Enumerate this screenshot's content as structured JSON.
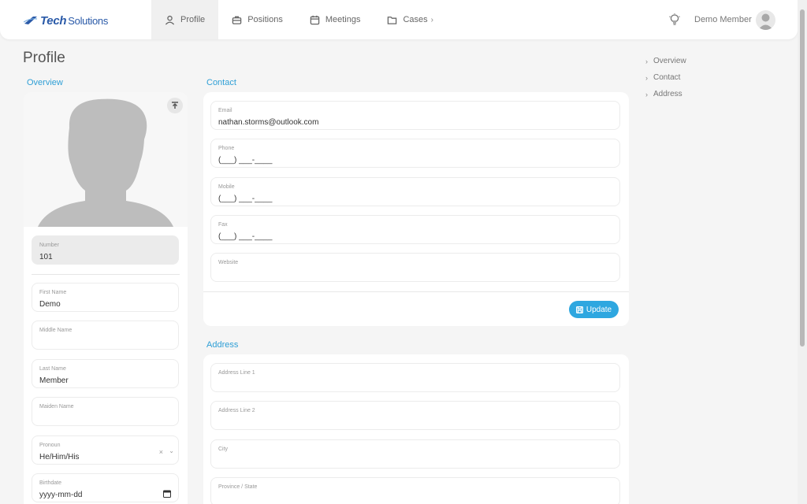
{
  "brand": {
    "tech": "Tech",
    "solutions": "Solutions"
  },
  "nav": {
    "items": [
      {
        "label": "Profile",
        "icon": "user-icon",
        "active": true
      },
      {
        "label": "Positions",
        "icon": "briefcase-icon"
      },
      {
        "label": "Meetings",
        "icon": "calendar-icon"
      },
      {
        "label": "Cases",
        "icon": "folder-icon",
        "chevron": "›"
      }
    ]
  },
  "header": {
    "user_name": "Demo Member",
    "tip_icon": "lightbulb-icon"
  },
  "page": {
    "title": "Profile"
  },
  "sections": {
    "overview": "Overview",
    "contact": "Contact",
    "address": "Address"
  },
  "overview": {
    "fields": {
      "number": {
        "label": "Number",
        "value": "101"
      },
      "first_name": {
        "label": "First Name",
        "value": "Demo"
      },
      "middle_name": {
        "label": "Middle Name",
        "value": ""
      },
      "last_name": {
        "label": "Last Name",
        "value": "Member"
      },
      "maiden_name": {
        "label": "Maiden Name",
        "value": ""
      },
      "pronoun": {
        "label": "Pronoun",
        "value": "He/Him/His",
        "clear": "×",
        "chevron": "⌄"
      },
      "birthdate": {
        "label": "Birthdate",
        "value": "yyyy-mm-dd"
      }
    }
  },
  "contact": {
    "fields": {
      "email": {
        "label": "Email",
        "value": "nathan.storms@outlook.com"
      },
      "phone": {
        "label": "Phone",
        "value": "(___) ___-____"
      },
      "mobile": {
        "label": "Mobile",
        "value": "(___) ___-____"
      },
      "fax": {
        "label": "Fax",
        "value": "(___) ___-____"
      },
      "website": {
        "label": "Website",
        "value": ""
      }
    },
    "update_label": "Update"
  },
  "address": {
    "fields": {
      "line1": {
        "label": "Address Line 1",
        "value": ""
      },
      "line2": {
        "label": "Address Line 2",
        "value": ""
      },
      "city": {
        "label": "City",
        "value": ""
      },
      "province": {
        "label": "Province / State",
        "value": ""
      }
    }
  },
  "toc": {
    "items": [
      "Overview",
      "Contact",
      "Address"
    ],
    "chevron": "›"
  },
  "colors": {
    "accent": "#2ea7e0",
    "brand": "#2a5aa8",
    "section": "#2f9fd6"
  }
}
